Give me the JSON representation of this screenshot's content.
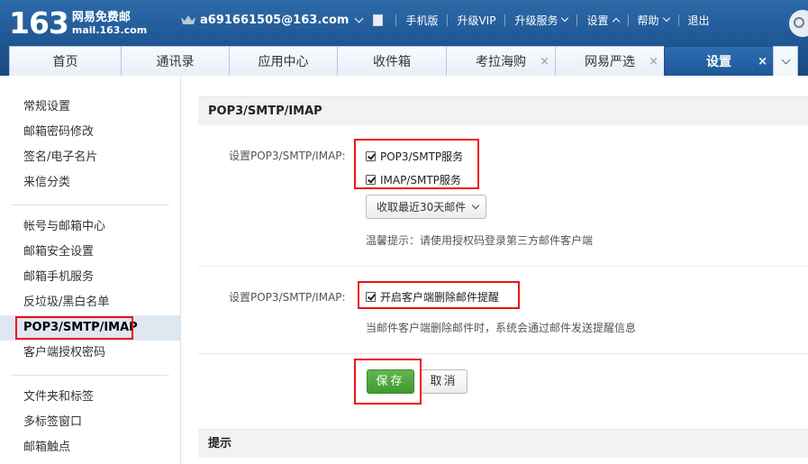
{
  "header": {
    "logo_number": "163",
    "logo_line1": "网易免费邮",
    "logo_line2": "mail.163.com",
    "account": "a691661505@163.com",
    "links": {
      "mobile": "手机版",
      "vip": "升级VIP",
      "service": "升级服务",
      "settings": "设置",
      "help": "帮助",
      "logout": "退出"
    }
  },
  "tabs": [
    {
      "label": "首页"
    },
    {
      "label": "通讯录"
    },
    {
      "label": "应用中心"
    },
    {
      "label": "收件箱"
    },
    {
      "label": "考拉海购",
      "close": "×"
    },
    {
      "label": "网易严选",
      "close": "×"
    },
    {
      "label": "设置",
      "close": "×"
    }
  ],
  "sidebar": {
    "items": [
      "常规设置",
      "邮箱密码修改",
      "签名/电子名片",
      "来信分类",
      "帐号与邮箱中心",
      "邮箱安全设置",
      "邮箱手机服务",
      "反垃圾/黑白名单",
      "POP3/SMTP/IMAP",
      "客户端授权密码",
      "文件夹和标签",
      "多标签窗口",
      "邮箱触点"
    ]
  },
  "main": {
    "section_title": "POP3/SMTP/IMAP",
    "row1_label": "设置POP3/SMTP/IMAP:",
    "pop3_smtp": "POP3/SMTP服务",
    "imap_smtp": "IMAP/SMTP服务",
    "dropdown_value": "收取最近30天邮件",
    "warm_tip": "温馨提示：请使用授权码登录第三方邮件客户端",
    "row2_label": "设置POP3/SMTP/IMAP:",
    "delete_notify": "开启客户端删除邮件提醒",
    "delete_notify_desc": "当邮件客户端删除邮件时，系统会通过邮件发送提醒信息",
    "save": "保存",
    "cancel": "取消",
    "tip_title": "提示"
  },
  "colors": {
    "header_blue": "#1e5593",
    "highlight_red": "#ee1111",
    "save_green": "#4fa83c"
  }
}
